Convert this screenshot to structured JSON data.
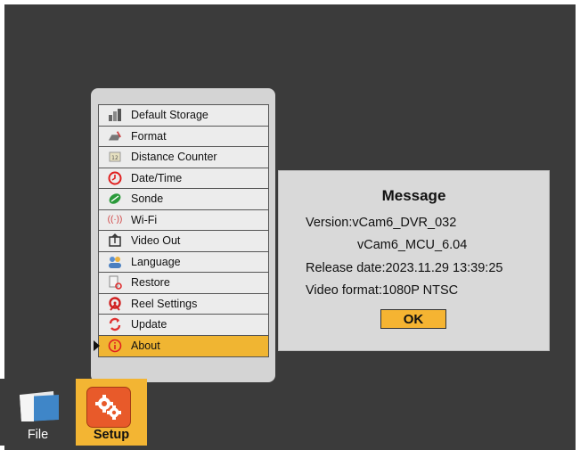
{
  "menu": {
    "items": [
      {
        "label": "Default Storage",
        "icon": "storage-icon"
      },
      {
        "label": "Format",
        "icon": "format-icon"
      },
      {
        "label": "Distance Counter",
        "icon": "counter-icon"
      },
      {
        "label": "Date/Time",
        "icon": "clock-icon"
      },
      {
        "label": "Sonde",
        "icon": "sonde-icon"
      },
      {
        "label": "Wi-Fi",
        "icon": "wifi-icon"
      },
      {
        "label": "Video Out",
        "icon": "video-out-icon"
      },
      {
        "label": "Language",
        "icon": "language-icon"
      },
      {
        "label": "Restore",
        "icon": "restore-icon"
      },
      {
        "label": "Reel Settings",
        "icon": "reel-icon"
      },
      {
        "label": "Update",
        "icon": "update-icon"
      },
      {
        "label": "About",
        "icon": "info-icon",
        "selected": true
      }
    ]
  },
  "dialog": {
    "title": "Message",
    "version_line": "Version:vCam6_DVR_032",
    "mcu_line": "vCam6_MCU_6.04",
    "release_line": "Release date:2023.11.29 13:39:25",
    "video_format_line": "Video format:1080P NTSC",
    "ok_label": "OK"
  },
  "tray": {
    "file_label": "File",
    "setup_label": "Setup"
  },
  "colors": {
    "background": "#3b3b3b",
    "accent": "#f0b532",
    "panel": "#d4d4d4"
  }
}
